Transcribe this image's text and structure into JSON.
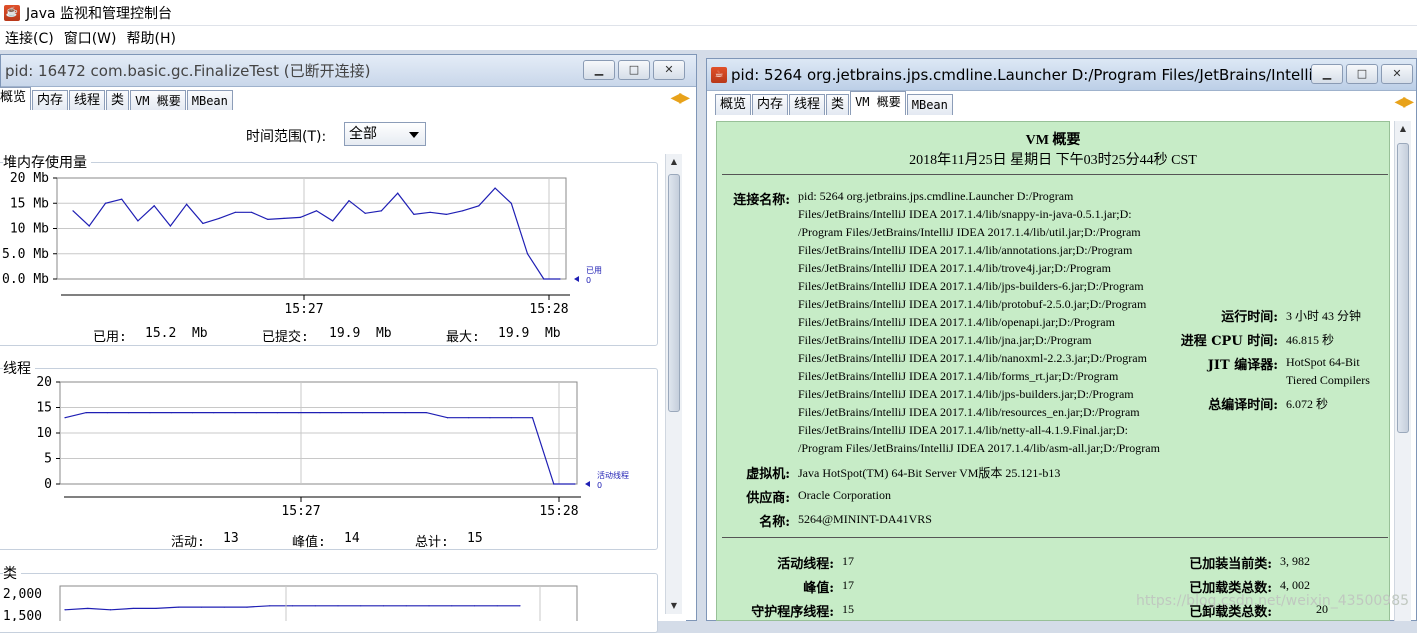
{
  "app": {
    "title": "Java 监视和管理控制台"
  },
  "menu": [
    "连接(C)",
    "窗口(W)",
    "帮助(H)"
  ],
  "left_window": {
    "title": "pid: 16472 com.basic.gc.FinalizeTest (已断开连接)",
    "tabs": [
      "概览",
      "内存",
      "线程",
      "类",
      "VM 概要",
      "MBean"
    ],
    "time_range_label": "时间范围(T):",
    "time_range_value": "全部",
    "heap": {
      "title": "堆内存使用量",
      "y_ticks": [
        "20 Mb",
        "15 Mb",
        "10 Mb",
        "5.0 Mb",
        "0.0 Mb"
      ],
      "x_ticks": [
        "15:27",
        "15:28"
      ],
      "legend_name": "已用",
      "legend_value": "0",
      "stats": [
        {
          "label": "已用:",
          "value": "15.2  Mb"
        },
        {
          "label": "已提交:",
          "value": "19.9  Mb"
        },
        {
          "label": "最大:",
          "value": "19.9  Mb"
        }
      ]
    },
    "threads": {
      "title": "线程",
      "y_ticks": [
        "20",
        "15",
        "10",
        "5",
        "0"
      ],
      "x_ticks": [
        "15:27",
        "15:28"
      ],
      "legend_name": "活动线程",
      "legend_value": "0",
      "stats": [
        {
          "label": "活动:",
          "value": "13"
        },
        {
          "label": "峰值:",
          "value": "14"
        },
        {
          "label": "总计:",
          "value": "15"
        }
      ]
    },
    "classes": {
      "title": "类",
      "y_ticks": [
        "2,000",
        "1,500"
      ]
    }
  },
  "right_window": {
    "title": "pid: 5264 org.jetbrains.jps.cmdline.Launcher D:/Program Files/JetBrains/Intelli...",
    "tabs": [
      "概览",
      "内存",
      "线程",
      "类",
      "VM 概要",
      "MBean"
    ],
    "summary": {
      "heading": "VM 概要",
      "date": "2018年11月25日 星期日 下午03时25分44秒 CST",
      "conn_label": "连接名称:",
      "conn_lines": [
        "pid: 5264 org.jetbrains.jps.cmdline.Launcher D:/Program",
        "Files/JetBrains/IntelliJ IDEA 2017.1.4/lib/snappy-in-java-0.5.1.jar;D:",
        "/Program Files/JetBrains/IntelliJ IDEA 2017.1.4/lib/util.jar;D:/Program",
        "Files/JetBrains/IntelliJ IDEA 2017.1.4/lib/annotations.jar;D:/Program",
        "Files/JetBrains/IntelliJ IDEA 2017.1.4/lib/trove4j.jar;D:/Program",
        "Files/JetBrains/IntelliJ IDEA 2017.1.4/lib/jps-builders-6.jar;D:/Program",
        "Files/JetBrains/IntelliJ IDEA 2017.1.4/lib/protobuf-2.5.0.jar;D:/Program",
        "Files/JetBrains/IntelliJ IDEA 2017.1.4/lib/openapi.jar;D:/Program",
        "Files/JetBrains/IntelliJ IDEA 2017.1.4/lib/jna.jar;D:/Program",
        "Files/JetBrains/IntelliJ IDEA 2017.1.4/lib/nanoxml-2.2.3.jar;D:/Program",
        "Files/JetBrains/IntelliJ IDEA 2017.1.4/lib/forms_rt.jar;D:/Program",
        "Files/JetBrains/IntelliJ IDEA 2017.1.4/lib/jps-builders.jar;D:/Program",
        "Files/JetBrains/IntelliJ IDEA 2017.1.4/lib/resources_en.jar;D:/Program",
        "Files/JetBrains/IntelliJ IDEA 2017.1.4/lib/netty-all-4.1.9.Final.jar;D:",
        "/Program Files/JetBrains/IntelliJ IDEA 2017.1.4/lib/asm-all.jar;D:/Program"
      ],
      "uptime_label": "运行时间:",
      "uptime_value": "3 小时 43 分钟",
      "cpu_label": "进程 CPU 时间:",
      "cpu_value": "46.815 秒",
      "jit_label": "JIT 编译器:",
      "jit_value_1": "HotSpot 64-Bit",
      "jit_value_2": "Tiered Compilers",
      "compile_label": "总编译时间:",
      "compile_value": "6.072 秒",
      "vm_label": "虚拟机:",
      "vm_value": "Java HotSpot(TM) 64-Bit Server VM版本 25.121-b13",
      "vendor_label": "供应商:",
      "vendor_value": "Oracle Corporation",
      "name_label": "名称:",
      "name_value": "5264@MININT-DA41VRS",
      "live_threads_label": "活动线程:",
      "live_threads_value": "17",
      "peak_label": "峰值:",
      "peak_value": "17",
      "daemon_label": "守护程序线程:",
      "daemon_value": "15",
      "loaded_label": "已加装当前类:",
      "loaded_value": "3, 982",
      "total_loaded_label": "已加载类总数:",
      "total_loaded_value": "4, 002",
      "unloaded_label": "已卸载类总数:",
      "unloaded_value": "20"
    }
  },
  "watermark": "https://blog.csdn.net/weixin_43500985",
  "colors": {
    "series": "#1f1fb4",
    "vm_bg": "#c7ecc7",
    "grid": "#c8c8c8"
  },
  "chart_data": [
    {
      "type": "line",
      "title": "堆内存使用量",
      "series": [
        {
          "name": "已用",
          "values": [
            13.5,
            10.5,
            15,
            15.8,
            11.5,
            14.5,
            10.5,
            14.8,
            11,
            12,
            13.2,
            13.2,
            11.8,
            12,
            12.2,
            13.5,
            11.5,
            15.5,
            13,
            13.5,
            17,
            12.8,
            13.2,
            12.8,
            13.5,
            14.5,
            18,
            15,
            5,
            0,
            0
          ]
        }
      ],
      "ylim": [
        0,
        20
      ],
      "x_ticks": [
        "15:27",
        "15:28"
      ]
    },
    {
      "type": "line",
      "title": "线程",
      "series": [
        {
          "name": "活动线程",
          "values": [
            13,
            14,
            14,
            14,
            14,
            14,
            14,
            14,
            14,
            14,
            14,
            14,
            14,
            14,
            14,
            14,
            14,
            14,
            13,
            13,
            13,
            13,
            13,
            0,
            0
          ]
        }
      ],
      "ylim": [
        0,
        20
      ],
      "x_ticks": [
        "15:27",
        "15:28"
      ]
    },
    {
      "type": "line",
      "title": "类",
      "series": [
        {
          "name": "",
          "values": [
            1820,
            1830,
            1820,
            1830,
            1830,
            1840,
            1840,
            1840,
            1840,
            1850,
            1850,
            1850,
            1850,
            1850,
            1850,
            1850,
            1850,
            1850,
            1850,
            1850,
            1850
          ]
        }
      ],
      "ylim": [
        1500,
        2000
      ]
    }
  ]
}
